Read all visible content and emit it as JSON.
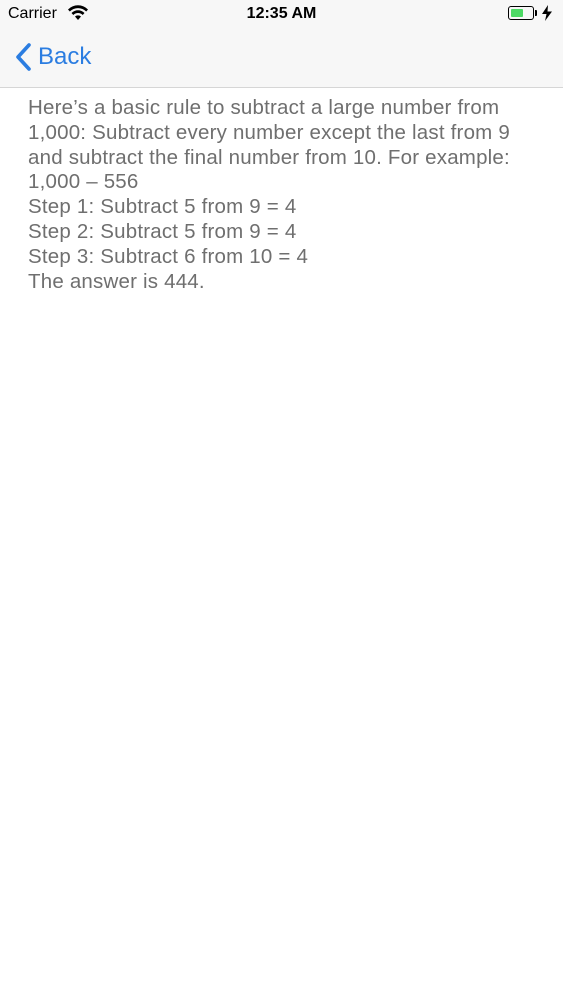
{
  "status_bar": {
    "carrier": "Carrier",
    "time": "12:35 AM",
    "battery_level": 0.62,
    "battery_color": "#4cd964"
  },
  "nav": {
    "back_label": "Back",
    "back_icon": "chevron-left-icon",
    "accent_color": "#2b7de1"
  },
  "content": {
    "intro": "Here’s a basic rule to subtract a large number from 1,000: Subtract every number except the last from 9 and subtract the final number from 10. For example:",
    "problem": "1,000 – 556",
    "steps": [
      "Step 1: Subtract 5 from 9 = 4",
      "Step 2: Subtract 5 from 9 = 4",
      "Step 3: Subtract 6 from 10 = 4"
    ],
    "answer": "The answer is 444."
  }
}
